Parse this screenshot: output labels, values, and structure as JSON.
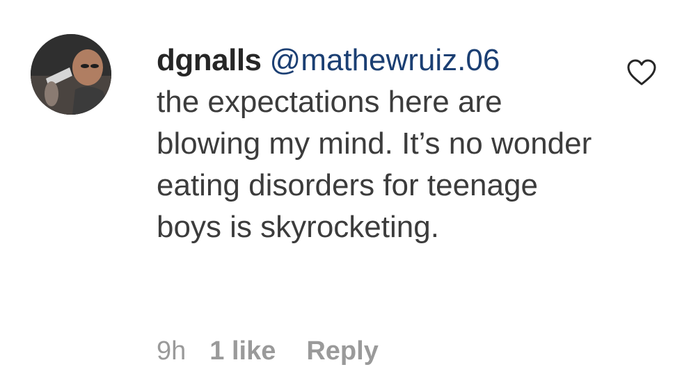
{
  "comment": {
    "username": "dgnalls",
    "mention": "@mathewruiz.06",
    "text": "the expectations here are blowing my mind. It’s no wonder eating disorders for teenage boys is skyrocketing.",
    "time": "9h",
    "likes": "1 like",
    "reply_label": "Reply",
    "avatar_icon": "user-avatar",
    "like_icon": "heart-outline-icon"
  },
  "colors": {
    "username": "#262626",
    "mention": "#1b3f73",
    "text": "#3c3c3c",
    "meta": "#9a9a9a"
  }
}
